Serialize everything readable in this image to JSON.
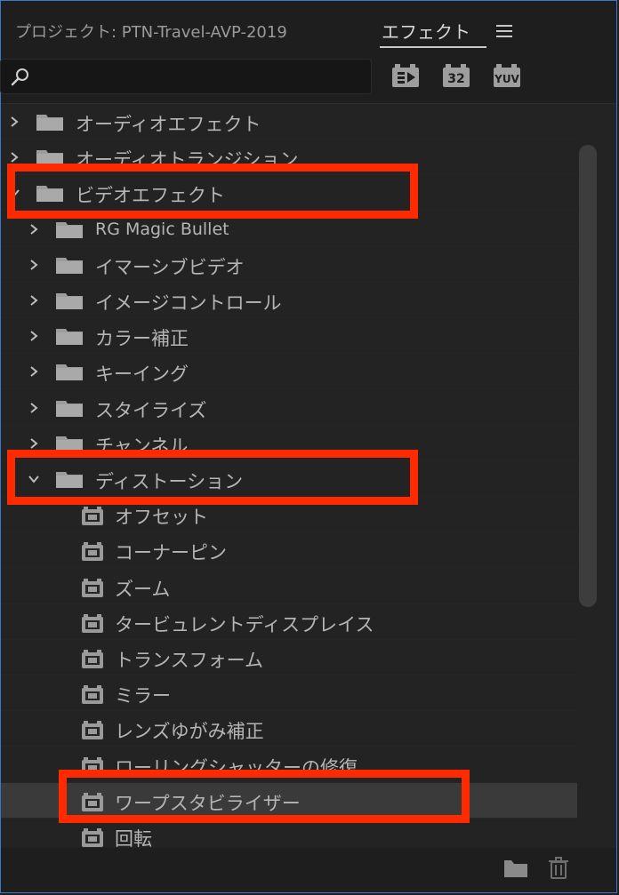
{
  "tabs": {
    "project_label": "プロジェクト: PTN-Travel-AVP-2019",
    "effects_label": "エフェクト"
  },
  "search": {
    "value": "",
    "placeholder": ""
  },
  "filters": {
    "accelerated_icon": "accelerated-effects-icon",
    "bit32_label": "32",
    "yuv_label": "YUV"
  },
  "tree": [
    {
      "label": "オーディオエフェクト",
      "type": "folder",
      "level": 0,
      "expanded": false
    },
    {
      "label": "オーディオトランジション",
      "type": "folder",
      "level": 0,
      "expanded": false
    },
    {
      "label": "ビデオエフェクト",
      "type": "folder",
      "level": 0,
      "expanded": true
    },
    {
      "label": "RG Magic Bullet",
      "type": "folder",
      "level": 1,
      "expanded": false
    },
    {
      "label": "イマーシブビデオ",
      "type": "folder",
      "level": 1,
      "expanded": false
    },
    {
      "label": "イメージコントロール",
      "type": "folder",
      "level": 1,
      "expanded": false
    },
    {
      "label": "カラー補正",
      "type": "folder",
      "level": 1,
      "expanded": false
    },
    {
      "label": "キーイング",
      "type": "folder",
      "level": 1,
      "expanded": false
    },
    {
      "label": "スタイライズ",
      "type": "folder",
      "level": 1,
      "expanded": false
    },
    {
      "label": "チャンネル",
      "type": "folder",
      "level": 1,
      "expanded": false
    },
    {
      "label": "ディストーション",
      "type": "folder",
      "level": 1,
      "expanded": true
    },
    {
      "label": "オフセット",
      "type": "effect",
      "level": 2
    },
    {
      "label": "コーナーピン",
      "type": "effect",
      "level": 2
    },
    {
      "label": "ズーム",
      "type": "effect",
      "level": 2
    },
    {
      "label": "タービュレントディスプレイス",
      "type": "effect",
      "level": 2
    },
    {
      "label": "トランスフォーム",
      "type": "effect",
      "level": 2
    },
    {
      "label": "ミラー",
      "type": "effect",
      "level": 2
    },
    {
      "label": "レンズゆがみ補正",
      "type": "effect",
      "level": 2
    },
    {
      "label": "ローリングシャッターの修復",
      "type": "effect",
      "level": 2
    },
    {
      "label": "ワープスタビライザー",
      "type": "effect",
      "level": 2,
      "selected": true
    },
    {
      "label": "回転",
      "type": "effect",
      "level": 2
    }
  ],
  "colors": {
    "highlight": "#ff2a00",
    "panel_border": "#3a78c9",
    "selected_row": "#3a3a3a"
  },
  "footer": {
    "new_bin_icon": "new-custom-bin-icon",
    "delete_icon": "trash-icon"
  }
}
